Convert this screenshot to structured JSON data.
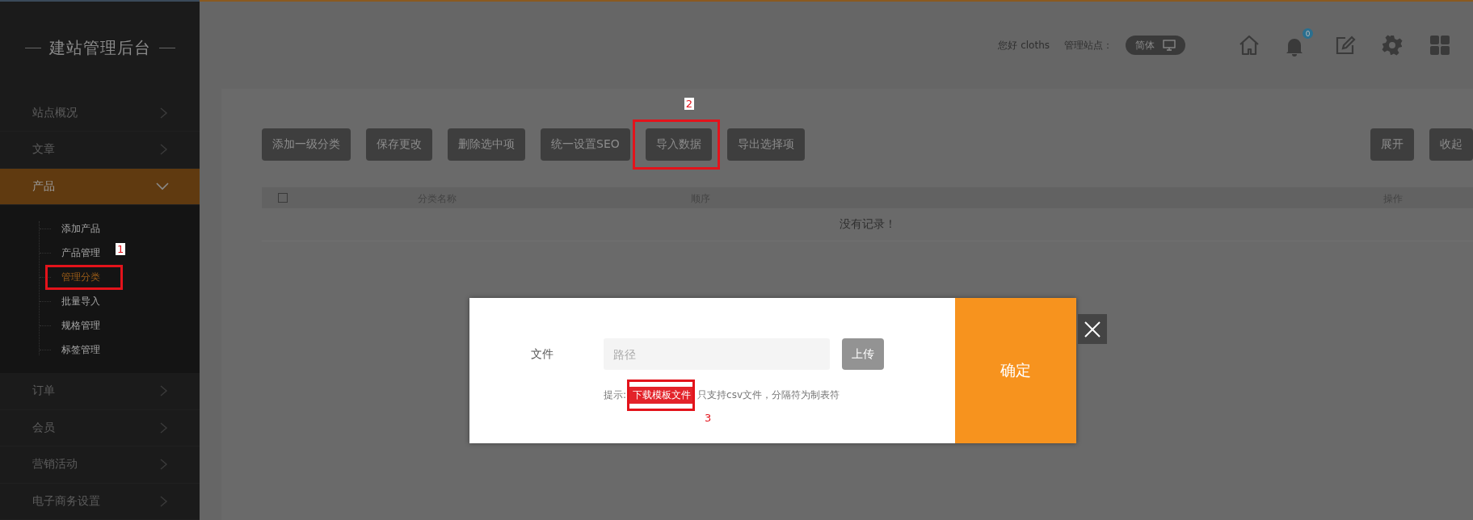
{
  "sidebar": {
    "logo": "建站管理后台",
    "items": [
      {
        "label": "站点概况",
        "selected": false,
        "expanded": false
      },
      {
        "label": "文章",
        "selected": false,
        "expanded": false
      },
      {
        "label": "产品",
        "selected": true,
        "expanded": true,
        "children": [
          {
            "label": "添加产品",
            "selected": false
          },
          {
            "label": "产品管理",
            "selected": false
          },
          {
            "label": "管理分类",
            "selected": true,
            "annotation": {
              "number": "1",
              "kind": "tag-above-right"
            }
          },
          {
            "label": "批量导入",
            "selected": false
          },
          {
            "label": "规格管理",
            "selected": false
          },
          {
            "label": "标签管理",
            "selected": false
          }
        ]
      },
      {
        "label": "订单",
        "selected": false,
        "expanded": false
      },
      {
        "label": "会员",
        "selected": false,
        "expanded": false
      },
      {
        "label": "营销活动",
        "selected": false,
        "expanded": false
      },
      {
        "label": "电子商务设置",
        "selected": false,
        "expanded": false
      }
    ]
  },
  "header": {
    "greeting": "您好 cloths",
    "site_label": "管理站点：",
    "language": "简体",
    "notification_count": "0"
  },
  "toolbar": {
    "buttons": [
      {
        "label": "添加一级分类"
      },
      {
        "label": "保存更改"
      },
      {
        "label": "删除选中项"
      },
      {
        "label": "统一设置SEO"
      },
      {
        "label": "导入数据",
        "annotation": {
          "number": "2",
          "kind": "tag-above"
        }
      },
      {
        "label": "导出选择项"
      }
    ],
    "right_buttons": [
      {
        "label": "展开"
      },
      {
        "label": "收起"
      }
    ]
  },
  "table": {
    "select_all_checked": false,
    "columns": [
      "分类名称",
      "顺序",
      "操作"
    ],
    "empty_message": "没有记录！"
  },
  "dialog": {
    "field_label": "文件",
    "placeholder": "路径",
    "upload_button": "上传",
    "hint_label": "提示:",
    "template_link": "下载模板文件",
    "template_annotation": {
      "number": "3",
      "kind": "plain-below-right"
    },
    "hint_text": "只支持csv文件，分隔符为制表符",
    "confirm_button": "确定"
  }
}
